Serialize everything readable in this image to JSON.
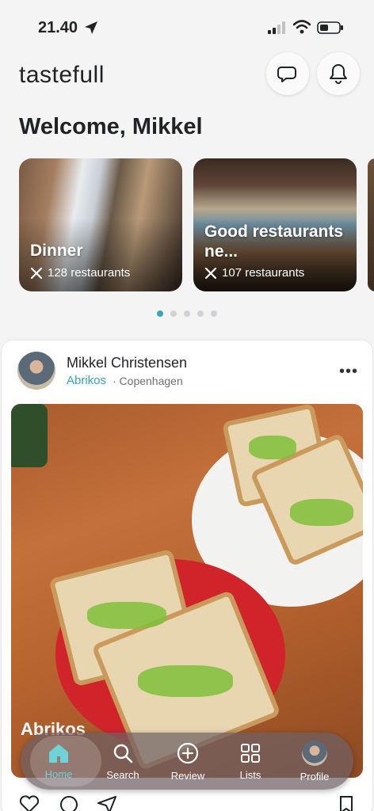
{
  "status_bar": {
    "time": "21.40"
  },
  "header": {
    "logo": "tastefull"
  },
  "welcome": "Welcome, Mikkel",
  "categories": [
    {
      "title": "Dinner",
      "count": "128 restaurants"
    },
    {
      "title": "Good restaurants ne...",
      "count": "107 restaurants"
    }
  ],
  "pagination": {
    "pages": 5,
    "active": 0
  },
  "post": {
    "author": "Mikkel Christensen",
    "restaurant": "Abrikos",
    "city": "· Copenhagen",
    "photo_caption": "Abrikos"
  },
  "tabs": [
    {
      "label": "Home",
      "icon": "home-icon",
      "active": true
    },
    {
      "label": "Search",
      "icon": "search-icon"
    },
    {
      "label": "Review",
      "icon": "plus-circle-icon"
    },
    {
      "label": "Lists",
      "icon": "grid-icon"
    },
    {
      "label": "Profile",
      "icon": "avatar"
    }
  ],
  "colors": {
    "accent": "#3aa6ad",
    "text": "#1f2326"
  }
}
